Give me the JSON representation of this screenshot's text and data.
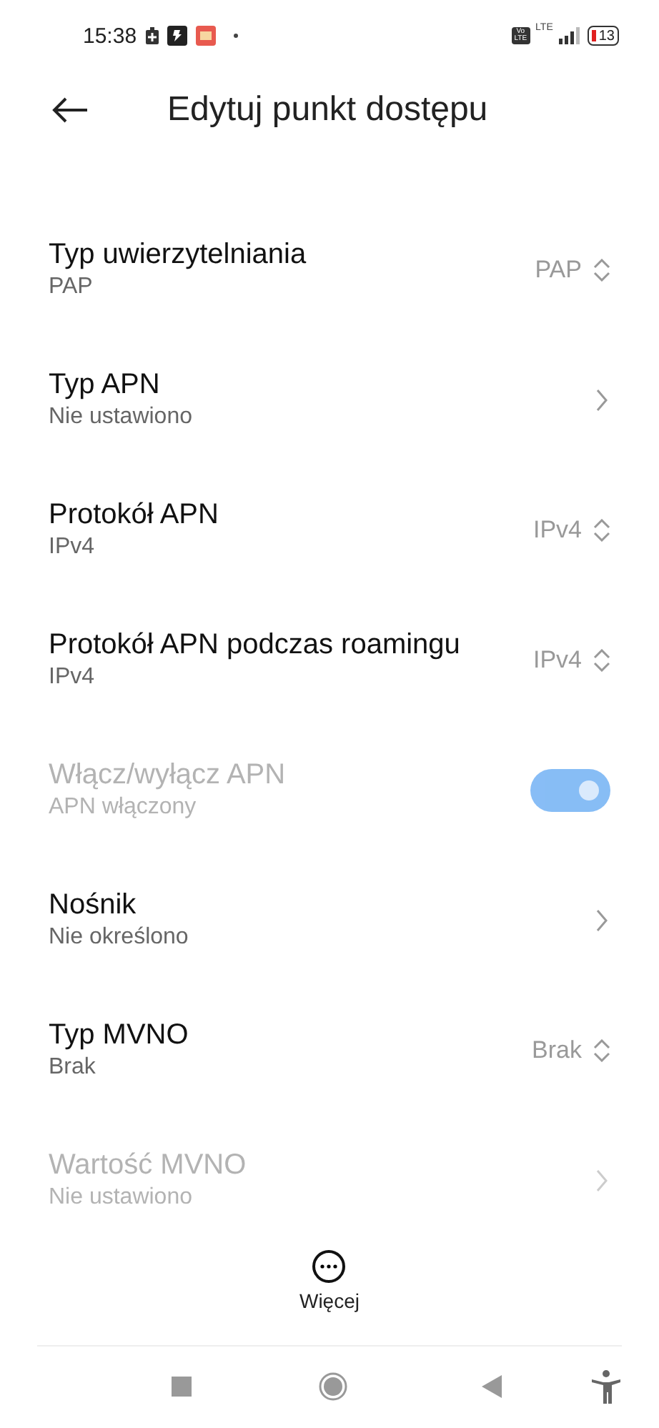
{
  "status_bar": {
    "time": "15:38",
    "volte": [
      "Vo",
      "LTE"
    ],
    "network": "LTE",
    "battery": "13"
  },
  "header": {
    "title": "Edytuj punkt dostępu"
  },
  "settings": [
    {
      "kind": "select",
      "title": "Typ uwierzytelniania",
      "subtitle": "PAP",
      "value": "PAP",
      "disabled": false
    },
    {
      "kind": "link",
      "title": "Typ APN",
      "subtitle": "Nie ustawiono",
      "disabled": false
    },
    {
      "kind": "select",
      "title": "Protokół APN",
      "subtitle": "IPv4",
      "value": "IPv4",
      "disabled": false
    },
    {
      "kind": "select",
      "title": "Protokół APN podczas roamingu",
      "subtitle": "IPv4",
      "value": "IPv4",
      "disabled": false
    },
    {
      "kind": "toggle",
      "title": "Włącz/wyłącz APN",
      "subtitle": "APN włączony",
      "on": true,
      "disabled": true
    },
    {
      "kind": "link",
      "title": "Nośnik",
      "subtitle": "Nie określono",
      "disabled": false
    },
    {
      "kind": "select",
      "title": "Typ MVNO",
      "subtitle": "Brak",
      "value": "Brak",
      "disabled": false
    },
    {
      "kind": "link",
      "title": "Wartość MVNO",
      "subtitle": "Nie ustawiono",
      "disabled": true
    }
  ],
  "more_button": {
    "label": "Więcej"
  }
}
